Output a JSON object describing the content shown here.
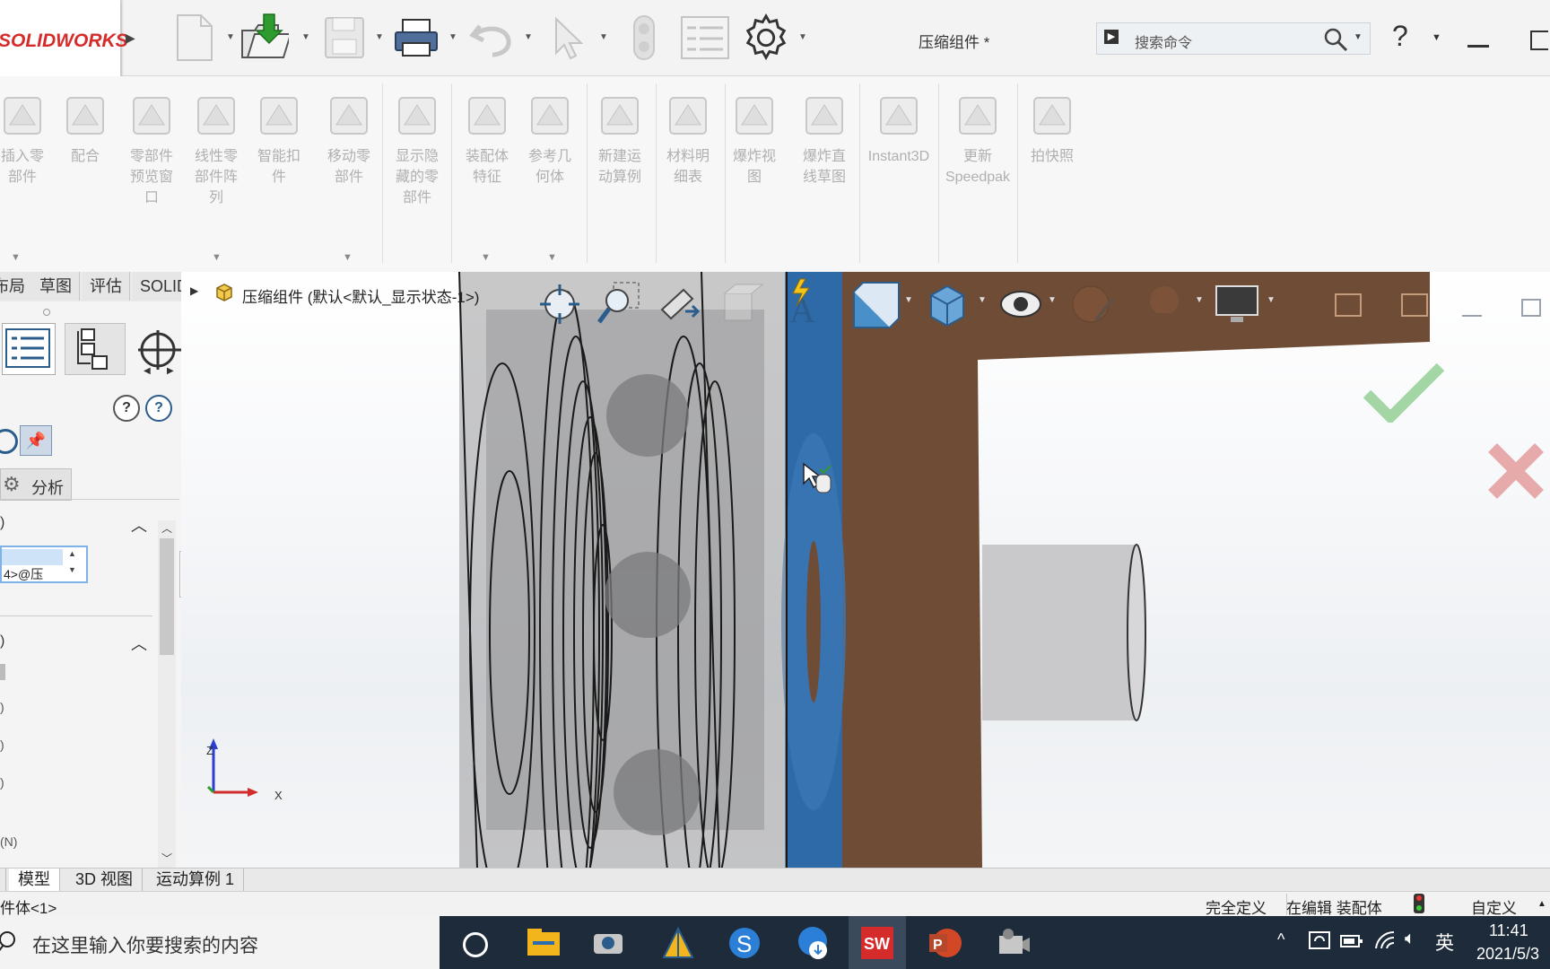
{
  "app": {
    "logo_text": "SOLIDWORKS",
    "doc_title": "压缩组件 *",
    "search_placeholder": "搜索命令",
    "help_label": "?"
  },
  "ribbon": {
    "buttons": [
      {
        "label": "插入零\n部件",
        "icon": "insert-component-icon"
      },
      {
        "label": "配合",
        "icon": "mate-icon"
      },
      {
        "label": "零部件\n预览窗\n口",
        "icon": "component-preview-icon"
      },
      {
        "label": "线性零\n部件阵\n列",
        "icon": "linear-pattern-icon"
      },
      {
        "label": "智能扣\n件",
        "icon": "smart-fasteners-icon"
      },
      {
        "label": "移动零\n部件",
        "icon": "move-component-icon"
      },
      {
        "label": "显示隐\n藏的零\n部件",
        "icon": "show-hidden-icon"
      },
      {
        "label": "装配体\n特征",
        "icon": "assembly-features-icon"
      },
      {
        "label": "参考几\n何体",
        "icon": "reference-geometry-icon"
      },
      {
        "label": "新建运\n动算例",
        "icon": "new-motion-study-icon"
      },
      {
        "label": "材料明\n细表",
        "icon": "bom-icon"
      },
      {
        "label": "爆炸视\n图",
        "icon": "exploded-view-icon"
      },
      {
        "label": "爆炸直\n线草图",
        "icon": "explode-line-sketch-icon"
      },
      {
        "label": "Instant3D",
        "icon": "instant3d-icon"
      },
      {
        "label": "更新\nSpeedpak",
        "icon": "speedpak-icon"
      },
      {
        "label": "拍快照",
        "icon": "snapshot-icon"
      }
    ]
  },
  "command_tabs": [
    "布局",
    "草图",
    "评估",
    "SOLIDWORKS MBD"
  ],
  "left_panel": {
    "analysis_label": "分析",
    "field_value": "4>@压",
    "row_label_n": "(N)"
  },
  "feature_tree": {
    "root_label": "压缩组件  (默认<默认_显示状态-1>)"
  },
  "triad": {
    "z": "Z",
    "x": "X"
  },
  "bottom_tabs": [
    "模型",
    "3D 视图",
    "运动算例 1"
  ],
  "status": {
    "left": "件体<1>",
    "fully_defined": "完全定义",
    "editing": "在编辑 装配体",
    "custom": "自定义"
  },
  "taskbar": {
    "search_text": "在这里输入你要搜索的内容",
    "time": "11:41",
    "date": "2021/5/3",
    "ime": "英"
  },
  "colors": {
    "brand_red": "#d52b2b",
    "part_brown": "#6e4c36",
    "flange_blue": "#2f6aa8",
    "taskbar": "#1d2b3a"
  }
}
